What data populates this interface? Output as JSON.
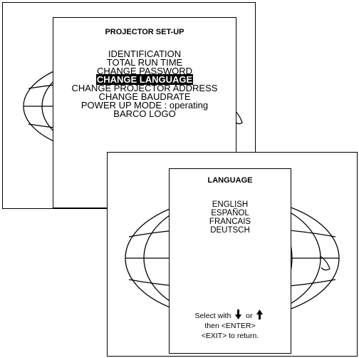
{
  "setup_menu": {
    "title": "PROJECTOR SET-UP",
    "items": [
      {
        "label": "IDENTIFICATION",
        "selected": false
      },
      {
        "label": "TOTAL RUN TIME",
        "selected": false
      },
      {
        "label": "CHANGE PASSWORD",
        "selected": false
      },
      {
        "label": "CHANGE LANGUAGE",
        "selected": true
      },
      {
        "label": "CHANGE PROJECTOR ADDRESS",
        "selected": false
      },
      {
        "label": "CHANGE BAUDRATE",
        "selected": false
      },
      {
        "label": "POWER UP MODE : operating",
        "selected": false
      },
      {
        "label": "BARCO LOGO",
        "selected": false
      }
    ]
  },
  "language_menu": {
    "title": "LANGUAGE",
    "items": [
      {
        "label": "ENGLISH"
      },
      {
        "label": "ESPAÑOL"
      },
      {
        "label": "FRANCAIS"
      },
      {
        "label": "DEUTSCH"
      }
    ],
    "hint": {
      "select_prefix": "Select with",
      "select_or": "or",
      "down_icon": "arrow-down-icon",
      "up_icon": "arrow-up-icon",
      "enter_line": "then <ENTER>",
      "exit_line": "<EXIT> to return."
    }
  },
  "colors": {
    "foreground": "#000000",
    "background": "#ffffff",
    "selection": "#000000"
  }
}
